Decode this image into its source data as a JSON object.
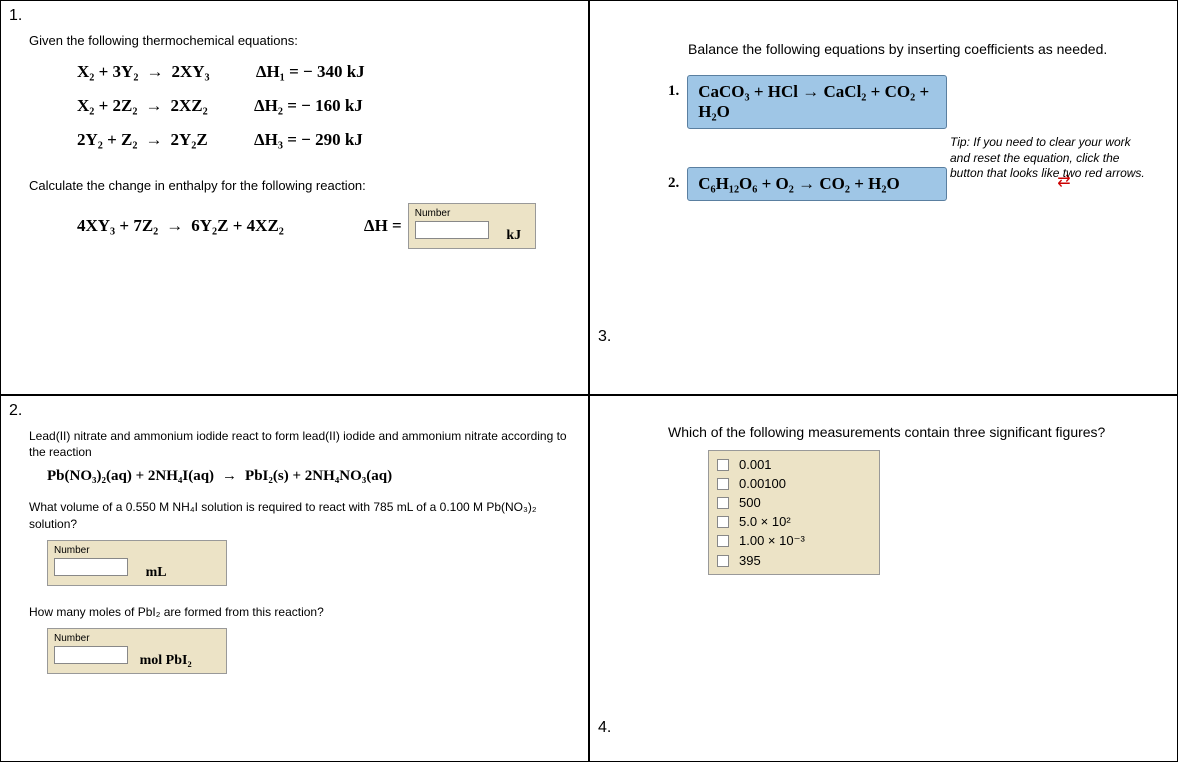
{
  "q1": {
    "num": "1.",
    "intro": "Given the following thermochemical equations:",
    "eq1_l": "X₂ + 3Y₂",
    "eq1_r": "2XY₃",
    "eq1_dh": "ΔH₁ = − 340  kJ",
    "eq2_l": "X₂ + 2Z₂",
    "eq2_r": "2XZ₂",
    "eq2_dh": "ΔH₂ = − 160  kJ",
    "eq3_l": "2Y₂ + Z₂",
    "eq3_r": "2Y₂Z",
    "eq3_dh": "ΔH₃ = − 290  kJ",
    "calc": "Calculate the change in enthalpy for the following reaction:",
    "final_l": "4XY₃ + 7Z₂",
    "final_r": "6Y₂Z + 4XZ₂",
    "dh_label": "ΔH =",
    "num_label": "Number",
    "unit": "kJ"
  },
  "q2": {
    "num": "2.",
    "intro": "Lead(II) nitrate and ammonium iodide react to form lead(II) iodide and ammonium nitrate according to the reaction",
    "eq_l": "Pb(NO₃)₂(aq) + 2NH₄I(aq)",
    "eq_r": "PbI₂(s) + 2NH₄NO₃(aq)",
    "ask1": "What volume of a 0.550 M NH₄I solution is required to react with 785 mL of a 0.100 M Pb(NO₃)₂ solution?",
    "num_label": "Number",
    "unit1": "mL",
    "ask2": "How many moles of PbI₂ are formed from this reaction?",
    "unit2": "mol  PbI₂"
  },
  "q3": {
    "intro": "Balance the following equations by inserting coefficients as needed.",
    "r1num": "1.",
    "r1eq": "CaCO₃ + HCl  →  CaCl₂ + CO₂ + H₂O",
    "r2num": "2.",
    "r2eq": "C₆H₁₂O₆ + O₂  →  CO₂ + H₂O",
    "tip": "Tip: If you need to clear your work and reset the equation, click the button that looks like two red arrows.",
    "q3num": "3.",
    "sigfig_q": "Which of the following measurements contain three significant figures?",
    "options": [
      "0.001",
      "0.00100",
      "500",
      "5.0 × 10²",
      "1.00 × 10⁻³",
      "395"
    ],
    "q4num": "4."
  }
}
